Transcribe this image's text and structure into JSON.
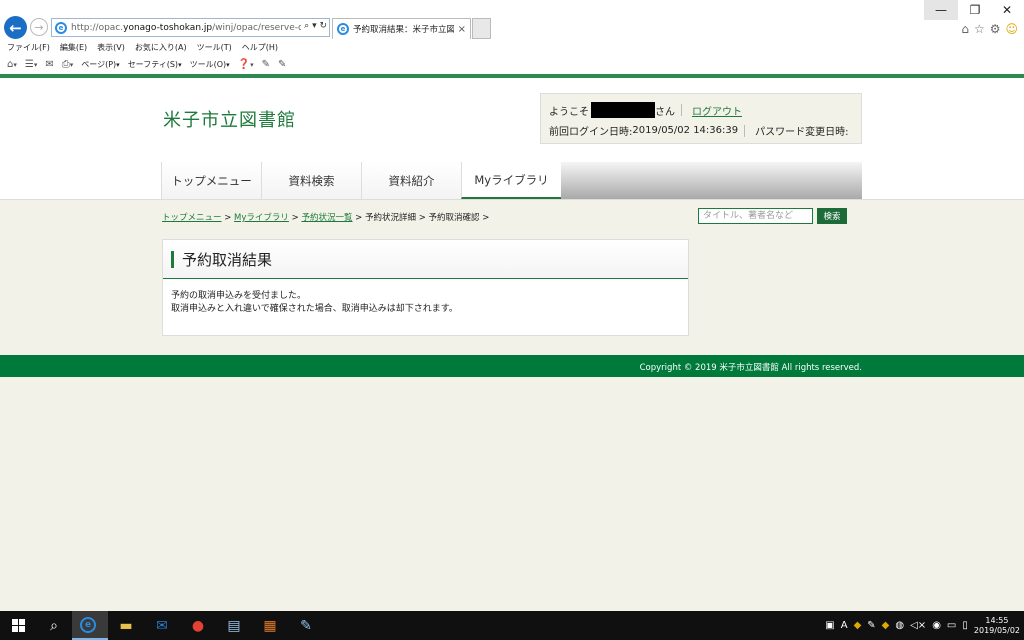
{
  "browser": {
    "url_prefix": "http://opac.",
    "url_host": "yonago-toshokan.jp",
    "url_path": "/winj/opac/reserve-cancel",
    "addr_tools": "⌕ ▾ ↻",
    "tab_title": "予約取消結果：米子市立図...",
    "tab_close": "×",
    "window_minimize": "—",
    "window_restore": "❐",
    "window_close": "✕",
    "right_icons": {
      "home": "⌂",
      "favorites": "☆",
      "settings": "⚙",
      "feedback": "☺"
    }
  },
  "menubar": [
    "ファイル(F)",
    "編集(E)",
    "表示(V)",
    "お気に入り(A)",
    "ツール(T)",
    "ヘルプ(H)"
  ],
  "cmdbar": {
    "page": "ページ(P)",
    "safety": "セーフティ(S)",
    "tools": "ツール(O)"
  },
  "site": {
    "title": "米子市立図書館",
    "welcome": "ようこそ",
    "san": "さん",
    "logout": "ログアウト",
    "last_login_label": "前回ログイン日時:",
    "last_login_value": "2019/05/02 14:36:39",
    "password_changed_label": "パスワード変更日時:"
  },
  "gnav": [
    "トップメニュー",
    "資料検索",
    "資料紹介",
    "Myライブラリ"
  ],
  "breadcrumb": {
    "top": "トップメニュー",
    "my": "Myライブラリ",
    "list": "予約状況一覧",
    "detail": "予約状況詳細",
    "confirm": "予約取消確認",
    "sep": ">"
  },
  "search": {
    "placeholder": "タイトル、著者名など",
    "button": "検索"
  },
  "result": {
    "title": "予約取消結果",
    "line1": "予約の取消申込みを受付ました。",
    "line2": "取消申込みと入れ違いで確保された場合、取消申込みは却下されます。"
  },
  "footer": {
    "copyright": "Copyright © 2019 米子市立図書館 All rights reserved."
  },
  "taskbar": {
    "time": "14:55",
    "date": "2019/05/02"
  }
}
